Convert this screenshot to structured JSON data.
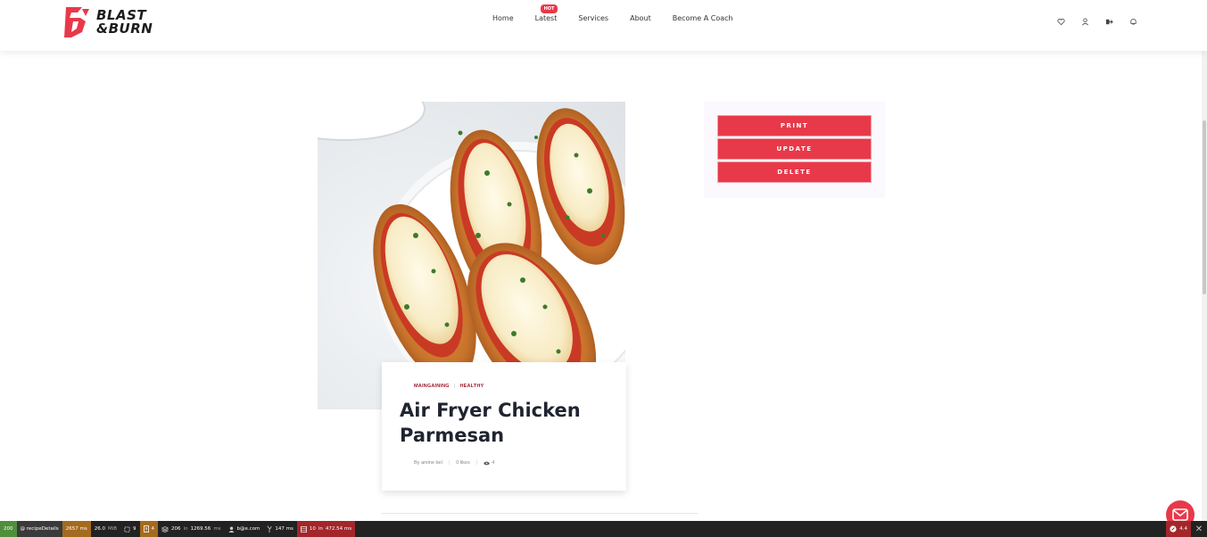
{
  "brand": {
    "line1": "BLAST",
    "line2": "&BURN"
  },
  "nav": {
    "items": [
      "Home",
      "Latest",
      "Services",
      "About",
      "Become A Coach"
    ],
    "hot_badge": "HOT"
  },
  "header_icons": [
    "heart-icon",
    "user-icon",
    "logout-icon",
    "bell-icon"
  ],
  "recipe": {
    "categories": [
      "MAINGAINING",
      "HEALTHY"
    ],
    "title": "Air Fryer Chicken Parmesan",
    "author": "By amine bel",
    "likes": "0 likes",
    "views": "4"
  },
  "actions": {
    "print": "PRINT",
    "update": "UPDATE",
    "delete": "DELETE"
  },
  "debugbar": {
    "status": "200",
    "route": "@ recipeDetails",
    "time": "2657 ms",
    "memory": "26.0",
    "memory_unit": "MiB",
    "forms": "9",
    "warnings": "4",
    "cache_count": "206",
    "cache_in": "in",
    "cache_time": "1269.56",
    "cache_unit": "ms",
    "user": "b@e.com",
    "twig": "147 ms",
    "db_count": "10",
    "db_in": "in",
    "db_time": "472.54 ms",
    "version": "4.4"
  },
  "colors": {
    "accent": "#e8394a",
    "title": "#1f2430",
    "category": "#9a1b2b",
    "debug_bg": "#222222"
  }
}
